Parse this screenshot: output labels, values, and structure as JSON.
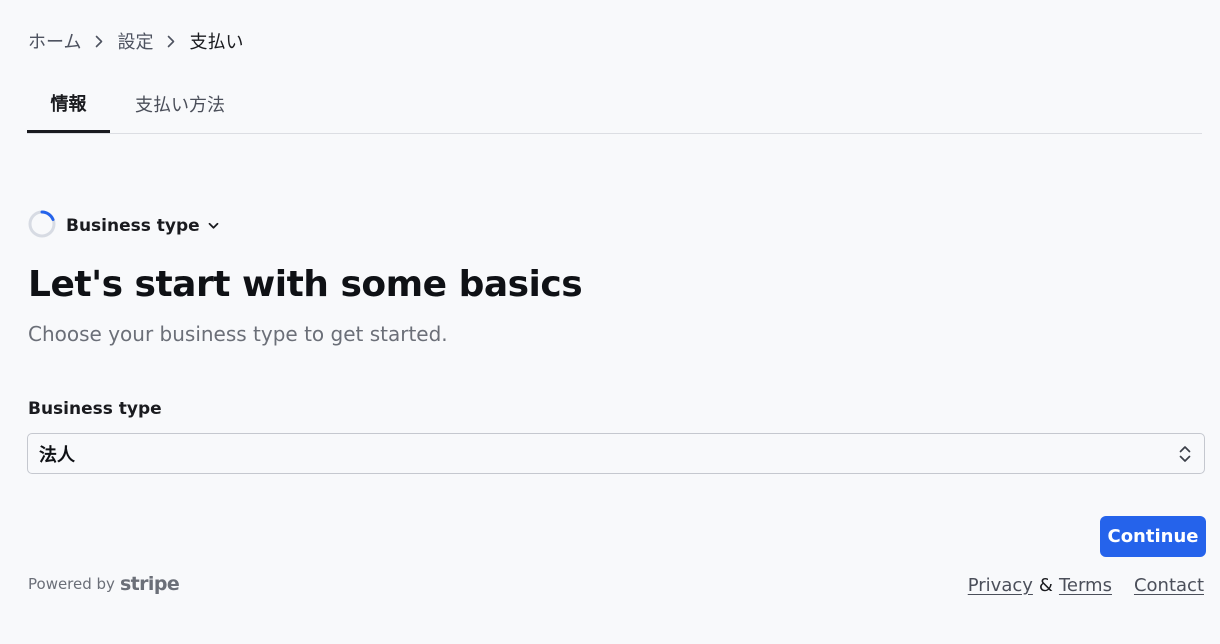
{
  "breadcrumb": {
    "items": [
      "ホーム",
      "設定",
      "支払い"
    ]
  },
  "tabs": [
    {
      "label": "情報",
      "active": true
    },
    {
      "label": "支払い方法",
      "active": false
    }
  ],
  "step": {
    "label": "Business type"
  },
  "heading": "Let's start with some basics",
  "subheading": "Choose your business type to get started.",
  "field": {
    "label": "Business type",
    "value": "法人"
  },
  "continue_label": "Continue",
  "footer": {
    "powered_by": "Powered by",
    "brand": "stripe",
    "privacy": "Privacy",
    "amp": "&",
    "terms": "Terms",
    "contact": "Contact"
  },
  "colors": {
    "accent": "#2563eb",
    "background": "#f8f9fb",
    "spinner_track": "#d7dbe3"
  },
  "icons": {
    "breadcrumb_separator": "chevron-right-icon",
    "step_status": "loading-spinner-icon",
    "step_toggle": "chevron-down-icon",
    "select_toggle": "chevron-up-down-icon"
  }
}
